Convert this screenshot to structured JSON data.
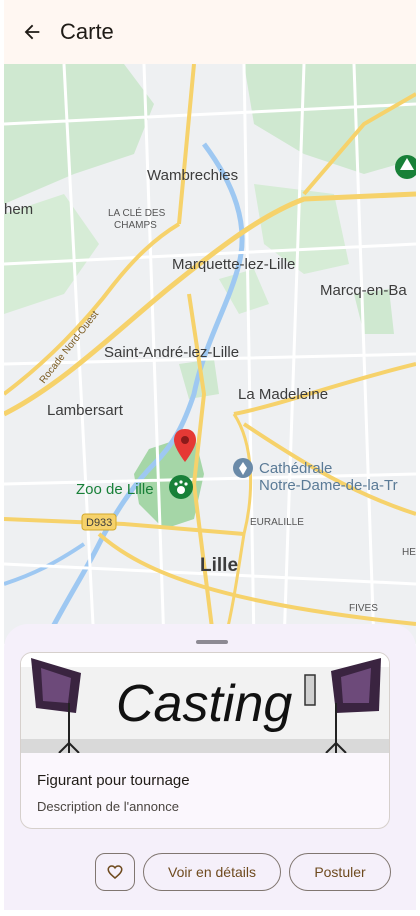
{
  "appbar": {
    "title": "Carte",
    "back_icon": "arrow-left-icon"
  },
  "map": {
    "places": {
      "wambrechies": "Wambrechies",
      "hem": "hem",
      "clos": "LA CLÉ DES",
      "clos2": "CHAMPS",
      "marquette": "Marquette-lez-Lille",
      "marcq": "Marcq-en-Ba",
      "rocade": "Rocade Nord-Ouest",
      "saint_andre": "Saint-André-lez-Lille",
      "madeleine": "La Madeleine",
      "lambersart": "Lambersart",
      "cathedrale1": "Cathédrale",
      "cathedrale2": "Notre-Dame-de-la-Tr",
      "zoo": "Zoo de Lille",
      "road": "D933",
      "euralille": "EURALILLE",
      "lille": "Lille",
      "fives": "FIVES",
      "he": "HE"
    },
    "marker_icon": "map-pin-icon",
    "colors": {
      "marker": "#e53935",
      "park": "#c8e6c9",
      "water": "#9ec8f2",
      "road_major": "#f6d26b",
      "zoo": "#188038"
    }
  },
  "card": {
    "image_text": "Casting",
    "title": "Figurant pour tournage",
    "description": "Description de l'annonce"
  },
  "actions": {
    "favorite_icon": "heart-icon",
    "details_label": "Voir en détails",
    "apply_label": "Postuler"
  }
}
